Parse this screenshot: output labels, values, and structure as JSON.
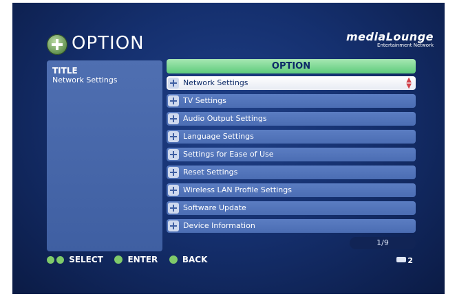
{
  "header": {
    "title": "OPTION",
    "brand_name": "mediaLounge",
    "brand_subtitle": "Entertainment Network"
  },
  "left_panel": {
    "label": "TITLE",
    "value": "Network Settings"
  },
  "options_panel": {
    "header": "OPTION",
    "items": [
      {
        "label": "Network Settings",
        "selected": true
      },
      {
        "label": "TV Settings",
        "selected": false
      },
      {
        "label": "Audio Output Settings",
        "selected": false
      },
      {
        "label": "Language Settings",
        "selected": false
      },
      {
        "label": "Settings for Ease of Use",
        "selected": false
      },
      {
        "label": "Reset Settings",
        "selected": false
      },
      {
        "label": "Wireless LAN Profile Settings",
        "selected": false
      },
      {
        "label": "Software Update",
        "selected": false
      },
      {
        "label": "Device Information",
        "selected": false
      }
    ],
    "page_indicator": "1/9"
  },
  "footer": {
    "select_label": "SELECT",
    "enter_label": "ENTER",
    "back_label": "BACK",
    "select_icon": "up-down-buttons-icon",
    "enter_icon": "enter-button-icon",
    "back_icon": "back-button-icon",
    "right_badge": "2"
  },
  "colors": {
    "background": "#15306f",
    "item": "#5577bb",
    "selected_item": "#ffffff",
    "header_green": "#6fcf86",
    "icon_green": "#7fca6a"
  }
}
